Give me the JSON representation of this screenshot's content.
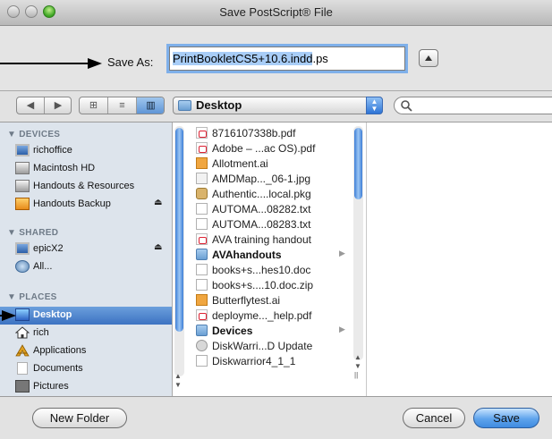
{
  "window": {
    "title": "Save PostScript® File"
  },
  "save_as": {
    "label": "Save As:",
    "filename_selected": "PrintBookletCS5+10.6.indd",
    "filename_extension": ".ps"
  },
  "toolbar": {
    "back_glyph": "◀",
    "forward_glyph": "▶",
    "view_icon_glyph": "⊞",
    "view_list_glyph": "≡",
    "view_column_glyph": "▥",
    "location": "Desktop",
    "search_placeholder": ""
  },
  "sidebar": {
    "devices_header": "▼ DEVICES",
    "shared_header": "▼ SHARED",
    "places_header": "▼ PLACES",
    "devices": [
      {
        "label": "richoffice",
        "icon": "monitor-icon"
      },
      {
        "label": "Macintosh HD",
        "icon": "hard-disk-icon"
      },
      {
        "label": "Handouts & Resources",
        "icon": "hard-disk-icon"
      },
      {
        "label": "Handouts Backup",
        "icon": "external-disk-icon",
        "eject": "⏏"
      }
    ],
    "shared": [
      {
        "label": "epicX2",
        "icon": "monitor-icon",
        "eject": "⏏"
      },
      {
        "label": "All...",
        "icon": "network-globe-icon"
      }
    ],
    "places": [
      {
        "label": "Desktop",
        "icon": "desktop-icon",
        "selected": true
      },
      {
        "label": "rich",
        "icon": "home-icon"
      },
      {
        "label": "Applications",
        "icon": "applications-icon"
      },
      {
        "label": "Documents",
        "icon": "documents-icon"
      },
      {
        "label": "Pictures",
        "icon": "pictures-icon"
      }
    ]
  },
  "files": [
    {
      "name": "8716107338b.pdf",
      "icon": "pdf"
    },
    {
      "name": "Adobe – ...ac OS).pdf",
      "icon": "pdf"
    },
    {
      "name": "Allotment.ai",
      "icon": "ai"
    },
    {
      "name": "AMDMap..._06-1.jpg",
      "icon": "jpg"
    },
    {
      "name": "Authentic....local.pkg",
      "icon": "pkg"
    },
    {
      "name": "AUTOMA...08282.txt",
      "icon": "txt"
    },
    {
      "name": "AUTOMA...08283.txt",
      "icon": "txt"
    },
    {
      "name": "AVA training handout",
      "icon": "pdf"
    },
    {
      "name": "AVAhandouts",
      "icon": "folder",
      "has_children": true
    },
    {
      "name": "books+s...hes10.doc",
      "icon": "doc"
    },
    {
      "name": "books+s....10.doc.zip",
      "icon": "doc"
    },
    {
      "name": "Butterflytest.ai",
      "icon": "ai"
    },
    {
      "name": "deployme..._help.pdf",
      "icon": "pdf"
    },
    {
      "name": "Devices",
      "icon": "folder",
      "has_children": true
    },
    {
      "name": "DiskWarri...D Update",
      "icon": "app"
    },
    {
      "name": "Diskwarrior4_1_1",
      "icon": "doc"
    }
  ],
  "buttons": {
    "new_folder": "New Folder",
    "cancel": "Cancel",
    "save": "Save"
  },
  "colors": {
    "selection": "#3c72c2",
    "default_button": "#5ea3ec",
    "sidebar_bg": "#dde4ec"
  }
}
